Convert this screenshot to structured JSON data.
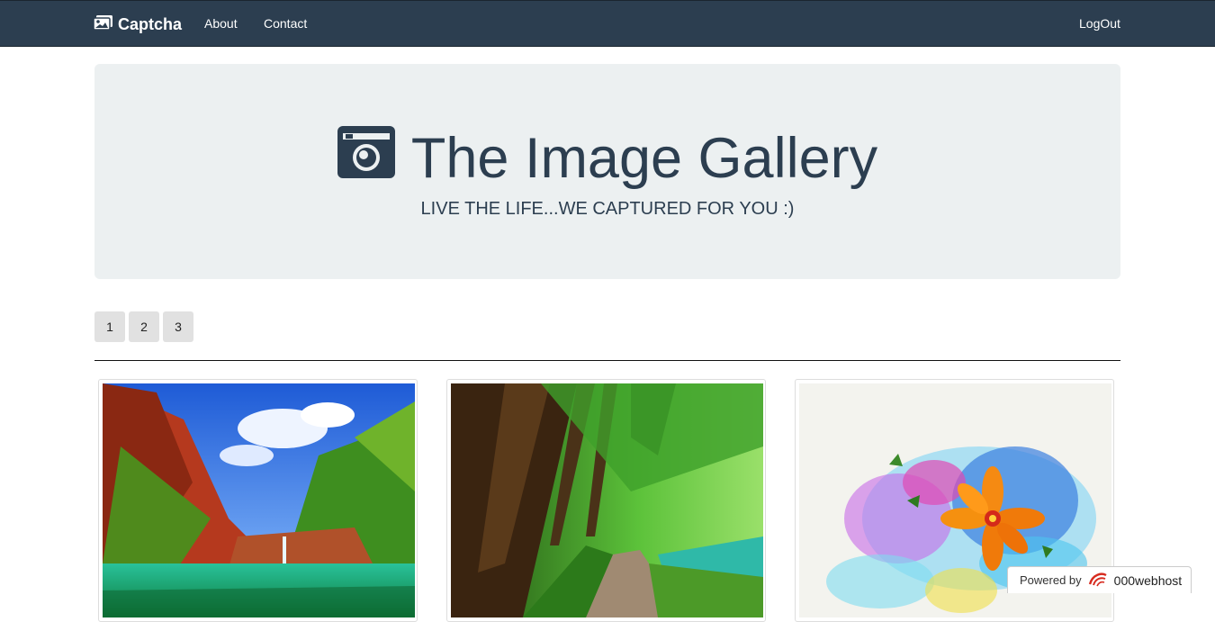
{
  "nav": {
    "brand": "Captcha",
    "brand_icon": "images-icon",
    "links": [
      {
        "label": "About"
      },
      {
        "label": "Contact"
      }
    ],
    "logout": "LogOut",
    "background": "#2c3e50"
  },
  "hero": {
    "title": "The Image Gallery",
    "title_icon": "camera-icon",
    "subtitle": "LIVE THE LIFE...WE CAPTURED FOR YOU :)",
    "background": "#ecf0f1",
    "text_color": "#2c3e50"
  },
  "pagination": {
    "pages": [
      "1",
      "2",
      "3"
    ]
  },
  "gallery": {
    "images": [
      {
        "name": "gallery-image-waterfall-landscape"
      },
      {
        "name": "gallery-image-forest-path"
      },
      {
        "name": "gallery-image-colorful-flower-art"
      }
    ]
  },
  "badge": {
    "prefix": "Powered by",
    "host": "000webhost",
    "logo_icon": "000webhost-logo-icon"
  }
}
